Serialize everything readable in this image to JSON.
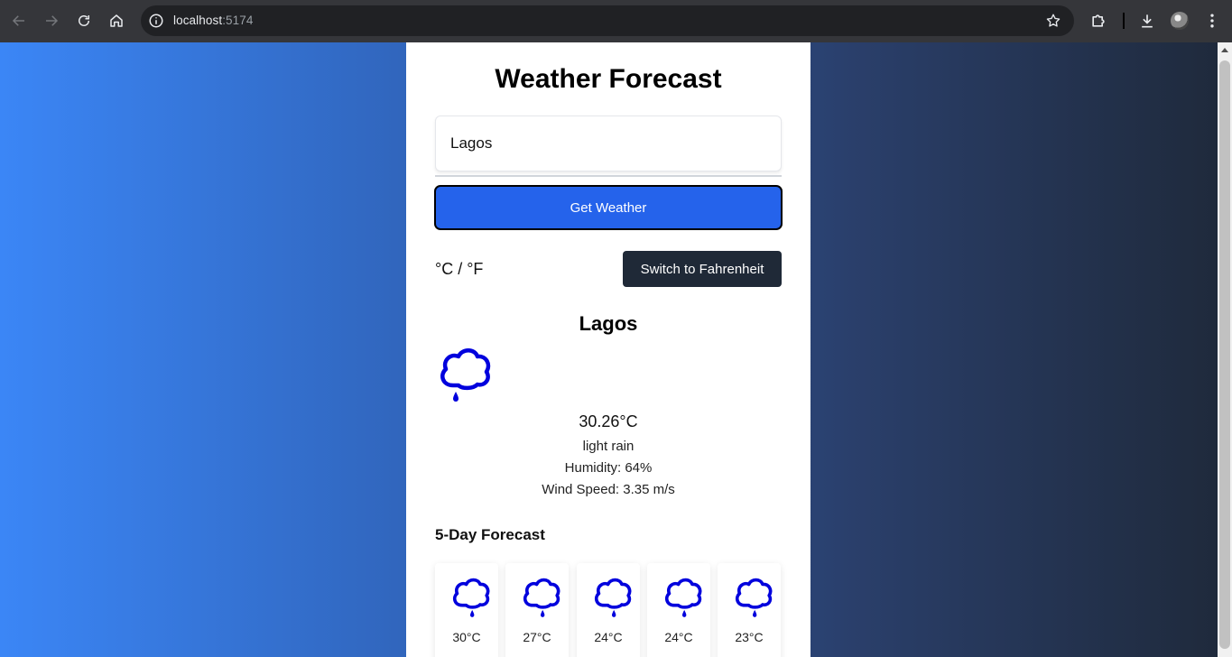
{
  "browser": {
    "url_host": "localhost",
    "url_port": ":5174"
  },
  "app": {
    "title": "Weather Forecast",
    "city_input_value": "Lagos",
    "get_weather_label": "Get Weather",
    "unit_label": "°C / °F",
    "switch_label": "Switch to Fahrenheit"
  },
  "current": {
    "city": "Lagos",
    "icon": "rain-cloud-icon",
    "temp": "30.26°C",
    "description": "light rain",
    "humidity": "Humidity: 64%",
    "wind": "Wind Speed: 3.35 m/s"
  },
  "forecast": {
    "title": "5-Day Forecast",
    "days": [
      {
        "temp": "30°C",
        "icon": "rain-cloud-icon"
      },
      {
        "temp": "27°C",
        "icon": "rain-cloud-icon"
      },
      {
        "temp": "24°C",
        "icon": "rain-cloud-icon"
      },
      {
        "temp": "24°C",
        "icon": "rain-cloud-icon"
      },
      {
        "temp": "23°C",
        "icon": "rain-cloud-icon"
      }
    ]
  },
  "colors": {
    "primary_button": "#2563eb",
    "dark_button": "#1f2937",
    "icon_blue": "#0000dd"
  }
}
